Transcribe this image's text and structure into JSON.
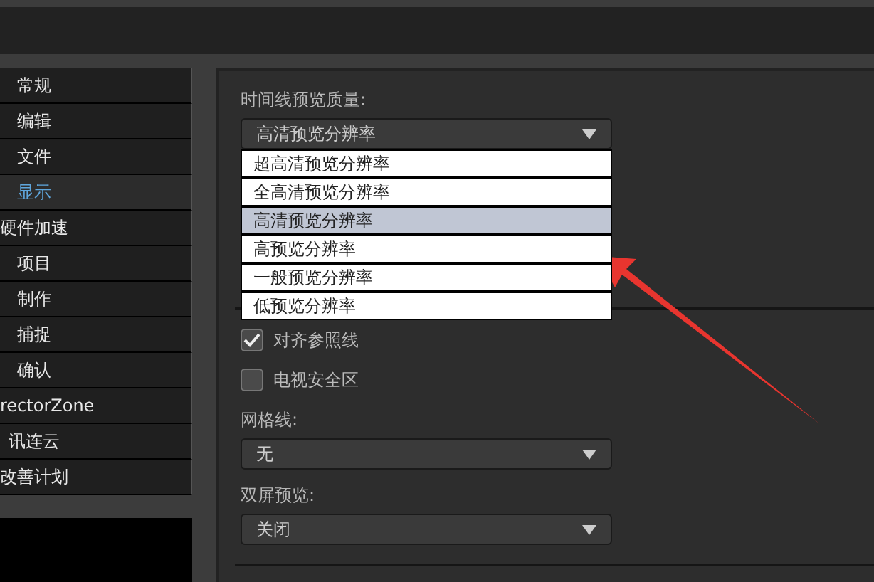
{
  "sidebar": {
    "items": [
      {
        "label": "常规",
        "selected": false
      },
      {
        "label": "编辑",
        "selected": false
      },
      {
        "label": "文件",
        "selected": false
      },
      {
        "label": "显示",
        "selected": true
      },
      {
        "label": "硬件加速",
        "selected": false
      },
      {
        "label": "项目",
        "selected": false
      },
      {
        "label": "制作",
        "selected": false
      },
      {
        "label": "捕捉",
        "selected": false
      },
      {
        "label": "确认",
        "selected": false
      },
      {
        "label": "rectorZone",
        "selected": false
      },
      {
        "label": "讯连云",
        "selected": false
      },
      {
        "label": "改善计划",
        "selected": false
      }
    ]
  },
  "preview_quality": {
    "label": "时间线预览质量:",
    "value": "高清预览分辨率",
    "expanded": true,
    "options": [
      {
        "label": "超高清预览分辨率",
        "selected": false
      },
      {
        "label": "全高清预览分辨率",
        "selected": false
      },
      {
        "label": "高清预览分辨率",
        "selected": true
      },
      {
        "label": "高预览分辨率",
        "selected": false
      },
      {
        "label": "一般预览分辨率",
        "selected": false
      },
      {
        "label": "低预览分辨率",
        "selected": false
      }
    ]
  },
  "checkboxes": [
    {
      "label": "对齐参照线",
      "checked": true
    },
    {
      "label": "电视安全区",
      "checked": false
    }
  ],
  "gridlines": {
    "label": "网格线:",
    "value": "无"
  },
  "dual_preview": {
    "label": "双屏预览:",
    "value": "关闭"
  }
}
